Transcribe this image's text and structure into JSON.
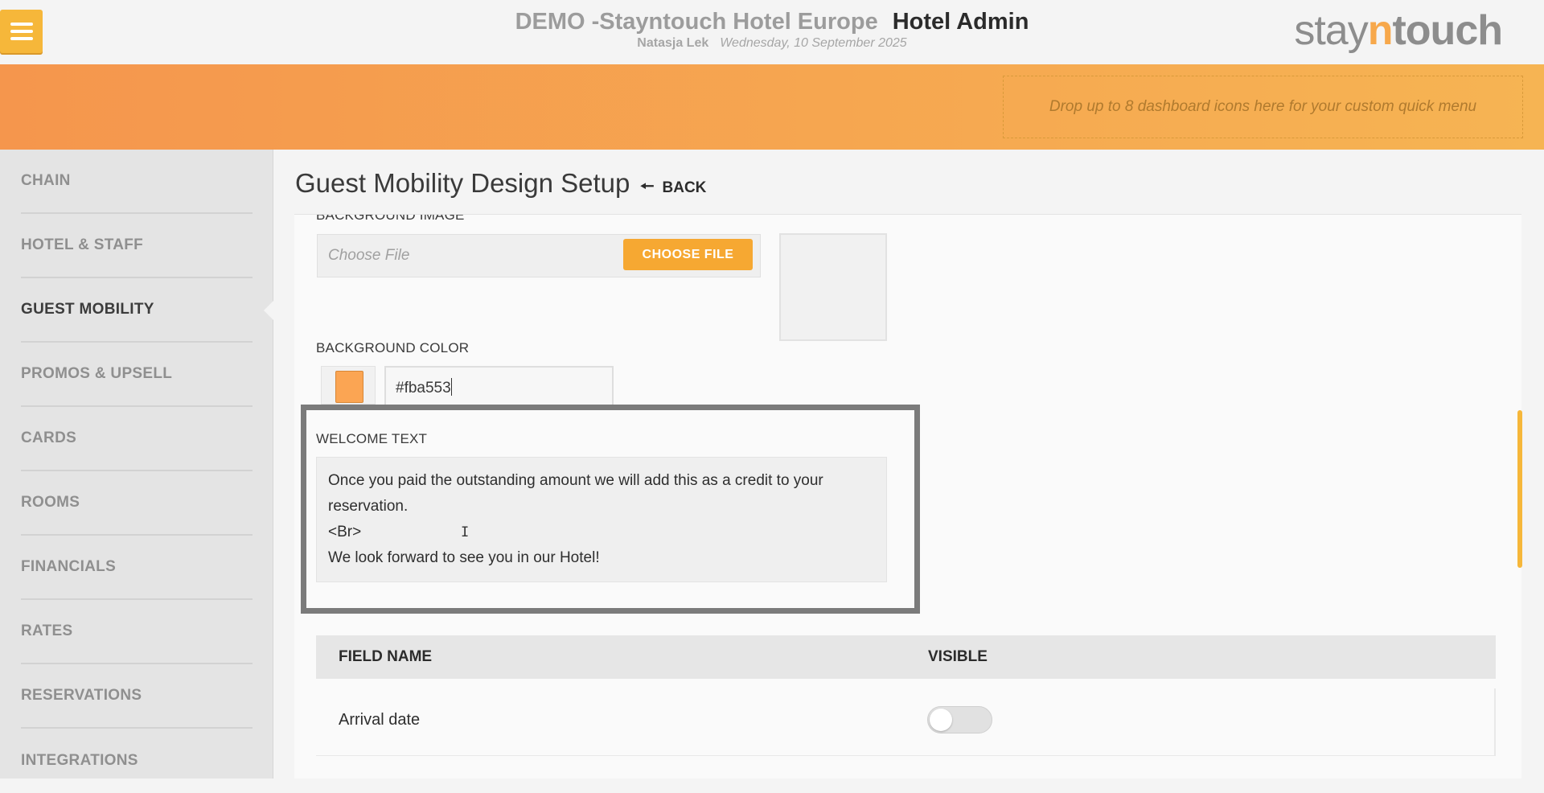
{
  "header": {
    "hotel_name": "DEMO -Stayntouch Hotel Europe",
    "app_title": "Hotel Admin",
    "user_name": "Natasja Lek",
    "date": "Wednesday, 10 September 2025",
    "logo": {
      "prefix": "stay",
      "mid": "n",
      "suffix": "touch"
    },
    "dropzone_text": "Drop up to 8 dashboard icons here for your custom quick menu"
  },
  "sidebar": {
    "items": [
      {
        "label": "CHAIN"
      },
      {
        "label": "HOTEL & STAFF"
      },
      {
        "label": "GUEST MOBILITY"
      },
      {
        "label": "PROMOS & UPSELL"
      },
      {
        "label": "CARDS"
      },
      {
        "label": "ROOMS"
      },
      {
        "label": "FINANCIALS"
      },
      {
        "label": "RATES"
      },
      {
        "label": "RESERVATIONS"
      },
      {
        "label": "INTEGRATIONS"
      }
    ],
    "active_index": 2
  },
  "page": {
    "title": "Guest Mobility Design Setup",
    "back_label": "BACK"
  },
  "form": {
    "background_image_label": "BACKGROUND IMAGE",
    "file_placeholder": "Choose File",
    "choose_file_label": "CHOOSE FILE",
    "background_color_label": "BACKGROUND COLOR",
    "background_color_value": "#fba553",
    "welcome_text_label": "WELCOME TEXT",
    "welcome_lines": [
      "Once you paid the outstanding amount we will add this as a credit to your",
      "reservation.",
      "<Br>",
      "We look forward to see you in our Hotel!"
    ]
  },
  "table": {
    "col_field": "FIELD NAME",
    "col_visible": "VISIBLE",
    "rows": [
      {
        "field": "Arrival date",
        "visible": false
      }
    ]
  },
  "colors": {
    "accent": "#f6b73a",
    "band_start": "#f5964d",
    "band_end": "#f6b453",
    "swatch": "#fba553"
  }
}
